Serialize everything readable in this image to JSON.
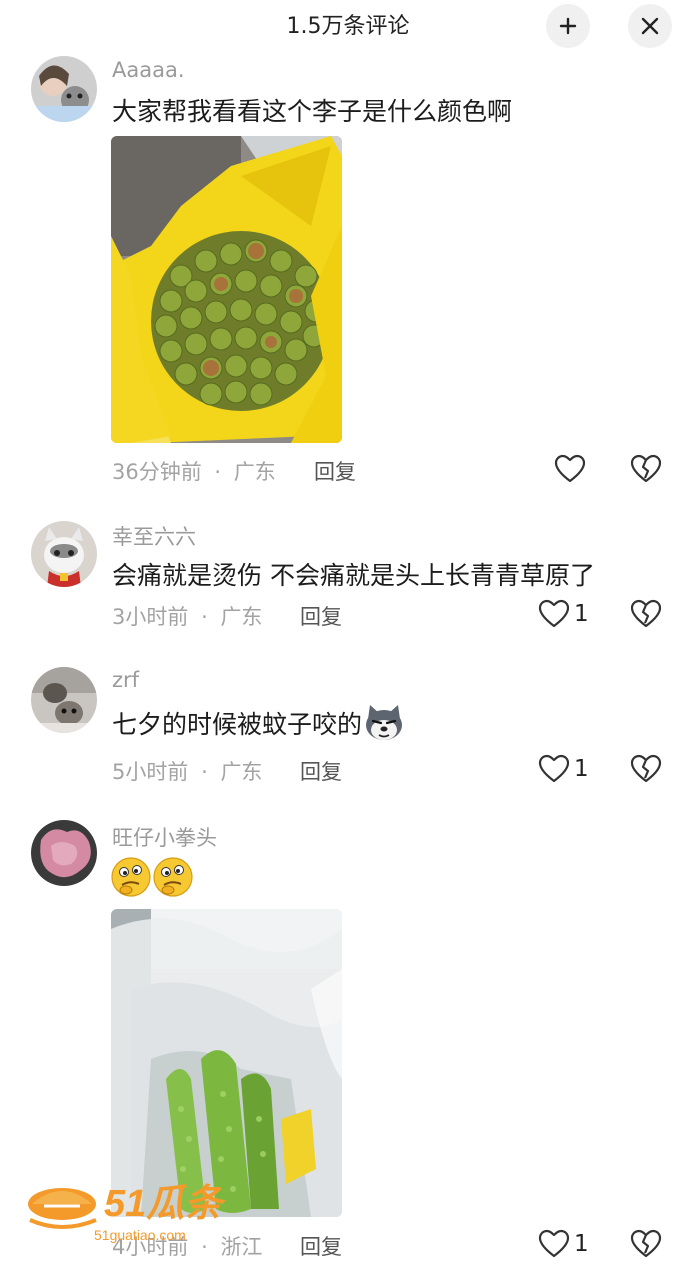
{
  "header": {
    "title": "1.5万条评论",
    "collapse_icon": "collapse-icon",
    "close_icon": "close-icon"
  },
  "comments": [
    {
      "username": "Aaaaa.",
      "text": "大家帮我看看这个李子是什么颜色啊",
      "time": "36分钟前",
      "sep": "·",
      "region": "广东",
      "reply": "回复",
      "likes": ""
    },
    {
      "username": "幸至六六",
      "text": "会痛就是烫伤 不会痛就是头上长青青草原了",
      "time": "3小时前",
      "sep": "·",
      "region": "广东",
      "reply": "回复",
      "likes": "1"
    },
    {
      "username": "zrf",
      "text": "七夕的时候被蚊子咬的",
      "time": "5小时前",
      "sep": "·",
      "region": "广东",
      "reply": "回复",
      "likes": "1"
    },
    {
      "username": "旺仔小拳头",
      "text": "",
      "time": "4小时前",
      "sep": "·",
      "region": "浙江",
      "reply": "回复",
      "likes": "1"
    }
  ],
  "watermark": {
    "brand": "51瓜条",
    "url": "51guatiao.com"
  }
}
